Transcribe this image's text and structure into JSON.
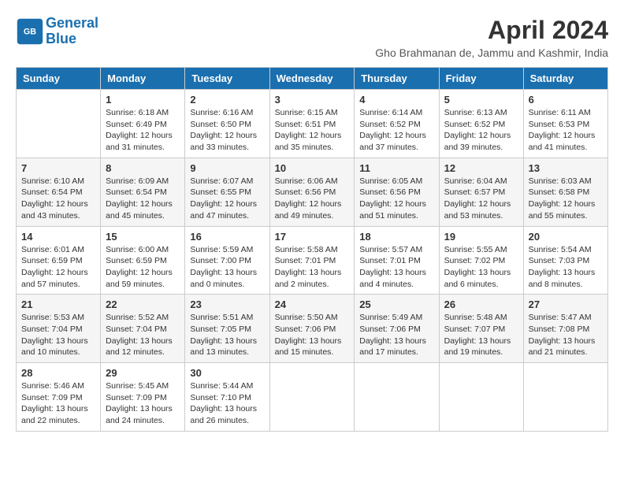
{
  "header": {
    "logo_line1": "General",
    "logo_line2": "Blue",
    "month_title": "April 2024",
    "location": "Gho Brahmanan de, Jammu and Kashmir, India"
  },
  "columns": [
    "Sunday",
    "Monday",
    "Tuesday",
    "Wednesday",
    "Thursday",
    "Friday",
    "Saturday"
  ],
  "weeks": [
    [
      {
        "day": "",
        "info": ""
      },
      {
        "day": "1",
        "info": "Sunrise: 6:18 AM\nSunset: 6:49 PM\nDaylight: 12 hours\nand 31 minutes."
      },
      {
        "day": "2",
        "info": "Sunrise: 6:16 AM\nSunset: 6:50 PM\nDaylight: 12 hours\nand 33 minutes."
      },
      {
        "day": "3",
        "info": "Sunrise: 6:15 AM\nSunset: 6:51 PM\nDaylight: 12 hours\nand 35 minutes."
      },
      {
        "day": "4",
        "info": "Sunrise: 6:14 AM\nSunset: 6:52 PM\nDaylight: 12 hours\nand 37 minutes."
      },
      {
        "day": "5",
        "info": "Sunrise: 6:13 AM\nSunset: 6:52 PM\nDaylight: 12 hours\nand 39 minutes."
      },
      {
        "day": "6",
        "info": "Sunrise: 6:11 AM\nSunset: 6:53 PM\nDaylight: 12 hours\nand 41 minutes."
      }
    ],
    [
      {
        "day": "7",
        "info": "Sunrise: 6:10 AM\nSunset: 6:54 PM\nDaylight: 12 hours\nand 43 minutes."
      },
      {
        "day": "8",
        "info": "Sunrise: 6:09 AM\nSunset: 6:54 PM\nDaylight: 12 hours\nand 45 minutes."
      },
      {
        "day": "9",
        "info": "Sunrise: 6:07 AM\nSunset: 6:55 PM\nDaylight: 12 hours\nand 47 minutes."
      },
      {
        "day": "10",
        "info": "Sunrise: 6:06 AM\nSunset: 6:56 PM\nDaylight: 12 hours\nand 49 minutes."
      },
      {
        "day": "11",
        "info": "Sunrise: 6:05 AM\nSunset: 6:56 PM\nDaylight: 12 hours\nand 51 minutes."
      },
      {
        "day": "12",
        "info": "Sunrise: 6:04 AM\nSunset: 6:57 PM\nDaylight: 12 hours\nand 53 minutes."
      },
      {
        "day": "13",
        "info": "Sunrise: 6:03 AM\nSunset: 6:58 PM\nDaylight: 12 hours\nand 55 minutes."
      }
    ],
    [
      {
        "day": "14",
        "info": "Sunrise: 6:01 AM\nSunset: 6:59 PM\nDaylight: 12 hours\nand 57 minutes."
      },
      {
        "day": "15",
        "info": "Sunrise: 6:00 AM\nSunset: 6:59 PM\nDaylight: 12 hours\nand 59 minutes."
      },
      {
        "day": "16",
        "info": "Sunrise: 5:59 AM\nSunset: 7:00 PM\nDaylight: 13 hours\nand 0 minutes."
      },
      {
        "day": "17",
        "info": "Sunrise: 5:58 AM\nSunset: 7:01 PM\nDaylight: 13 hours\nand 2 minutes."
      },
      {
        "day": "18",
        "info": "Sunrise: 5:57 AM\nSunset: 7:01 PM\nDaylight: 13 hours\nand 4 minutes."
      },
      {
        "day": "19",
        "info": "Sunrise: 5:55 AM\nSunset: 7:02 PM\nDaylight: 13 hours\nand 6 minutes."
      },
      {
        "day": "20",
        "info": "Sunrise: 5:54 AM\nSunset: 7:03 PM\nDaylight: 13 hours\nand 8 minutes."
      }
    ],
    [
      {
        "day": "21",
        "info": "Sunrise: 5:53 AM\nSunset: 7:04 PM\nDaylight: 13 hours\nand 10 minutes."
      },
      {
        "day": "22",
        "info": "Sunrise: 5:52 AM\nSunset: 7:04 PM\nDaylight: 13 hours\nand 12 minutes."
      },
      {
        "day": "23",
        "info": "Sunrise: 5:51 AM\nSunset: 7:05 PM\nDaylight: 13 hours\nand 13 minutes."
      },
      {
        "day": "24",
        "info": "Sunrise: 5:50 AM\nSunset: 7:06 PM\nDaylight: 13 hours\nand 15 minutes."
      },
      {
        "day": "25",
        "info": "Sunrise: 5:49 AM\nSunset: 7:06 PM\nDaylight: 13 hours\nand 17 minutes."
      },
      {
        "day": "26",
        "info": "Sunrise: 5:48 AM\nSunset: 7:07 PM\nDaylight: 13 hours\nand 19 minutes."
      },
      {
        "day": "27",
        "info": "Sunrise: 5:47 AM\nSunset: 7:08 PM\nDaylight: 13 hours\nand 21 minutes."
      }
    ],
    [
      {
        "day": "28",
        "info": "Sunrise: 5:46 AM\nSunset: 7:09 PM\nDaylight: 13 hours\nand 22 minutes."
      },
      {
        "day": "29",
        "info": "Sunrise: 5:45 AM\nSunset: 7:09 PM\nDaylight: 13 hours\nand 24 minutes."
      },
      {
        "day": "30",
        "info": "Sunrise: 5:44 AM\nSunset: 7:10 PM\nDaylight: 13 hours\nand 26 minutes."
      },
      {
        "day": "",
        "info": ""
      },
      {
        "day": "",
        "info": ""
      },
      {
        "day": "",
        "info": ""
      },
      {
        "day": "",
        "info": ""
      }
    ]
  ]
}
